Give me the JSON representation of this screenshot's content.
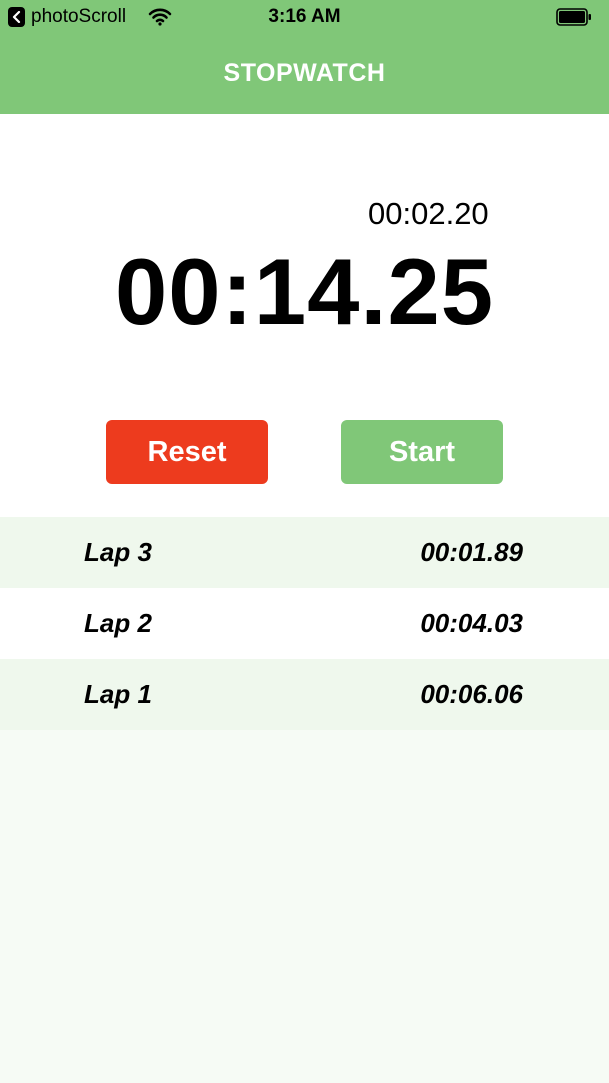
{
  "status_bar": {
    "back_app": "photoScroll",
    "time": "3:16 AM"
  },
  "header": {
    "title": "STOPWATCH",
    "color": "#80c778"
  },
  "timer": {
    "lap_time": "00:02.20",
    "total_time": "00:14.25"
  },
  "buttons": {
    "reset_label": "Reset",
    "start_label": "Start",
    "reset_color": "#ed3b1e",
    "start_color": "#80c778"
  },
  "laps": [
    {
      "name": "Lap 3",
      "time": "00:01.89"
    },
    {
      "name": "Lap 2",
      "time": "00:04.03"
    },
    {
      "name": "Lap 1",
      "time": "00:06.06"
    }
  ]
}
